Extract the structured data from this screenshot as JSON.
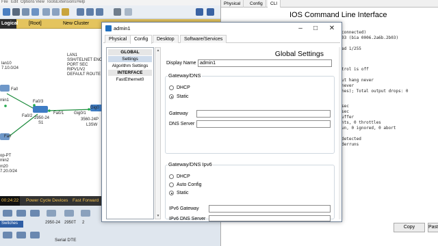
{
  "background_app": {
    "menu": [
      "File",
      "Edit",
      "Options",
      "View",
      "Tools",
      "Extensions",
      "Help"
    ],
    "topbar": {
      "logical": "Logical",
      "root": "[Root]",
      "new_cluster": "New Cluster"
    },
    "canvas_labels": [
      "lan10",
      "7.10.0/24",
      "Fa0",
      "min1",
      "Fa0/3",
      "Fa0/2",
      "S1",
      "2950-24",
      "Fa0/1",
      "Gig0/1",
      "Gig0",
      "3560-24P",
      "L3SW",
      "Fa0",
      "op-PT",
      "min2",
      "m20",
      "7.20.0/24",
      "LAN1",
      "SSH/TELNET ENCRY",
      "PORT SEC",
      "RIPV1/V2",
      "DEFAULT ROUTE"
    ],
    "status": {
      "time": "00:24:22",
      "power_cycle": "Power Cycle Devices",
      "fast_forward": "Fast Forward"
    },
    "devbar": {
      "category": "Switches",
      "models": [
        "2950-24",
        "2950T",
        "2"
      ],
      "connection": "Serial DTE"
    },
    "colors": {
      "topbar": "#e4c45e",
      "status_bg": "#333333",
      "status_text": "#f3c04d"
    }
  },
  "cli_window": {
    "tabs": [
      "Physical",
      "Config",
      "CLI"
    ],
    "active_tab": "CLI",
    "title": "IOS Command Line Interface",
    "lines": [
      "connected)",
      "03 (bia 0006.2a6b.2b03)",
      "",
      "ad 1/255",
      "",
      "",
      "trol is off",
      "",
      "ut hang never",
      "never",
      "hes); Total output drops: 0",
      "",
      "",
      "sec",
      "sec",
      "uffer",
      "nts, 0 throttles",
      "un, 0 ignored, 0 abort",
      "",
      "detected",
      "derruns"
    ],
    "buttons": {
      "copy": "Copy",
      "paste": "Paste"
    }
  },
  "window": {
    "title": "admin1",
    "controls": {
      "minimize": "–",
      "maximize": "□",
      "close": "✕"
    },
    "tabs": [
      "Physical",
      "Config",
      "Desktop",
      "Software/Services"
    ],
    "active_tab": "Config",
    "left_panel": {
      "global_header": "GLOBAL",
      "items_global": [
        "Settings",
        "Algorithm Settings"
      ],
      "interface_header": "INTERFACE",
      "items_interface": [
        "FastEthernet0"
      ],
      "selected": "Settings"
    },
    "global_settings": {
      "title": "Global Settings",
      "display_name_label": "Display Name",
      "display_name_value": "admin1",
      "gateway_dns": {
        "title": "Gateway/DNS",
        "dhcp": "DHCP",
        "static": "Static",
        "selected": "Static",
        "gateway_label": "Gateway",
        "gateway_value": "",
        "dns_label": "DNS Server",
        "dns_value": ""
      },
      "gateway_dns_ipv6": {
        "title": "Gateway/DNS Ipv6",
        "dhcp": "DHCP",
        "auto": "Auto Config",
        "static": "Static",
        "selected": "Static",
        "gateway_label": "IPv6 Gateway",
        "gateway_value": "",
        "dns_label": "IPv6 DNS Server",
        "dns_value": ""
      }
    }
  }
}
